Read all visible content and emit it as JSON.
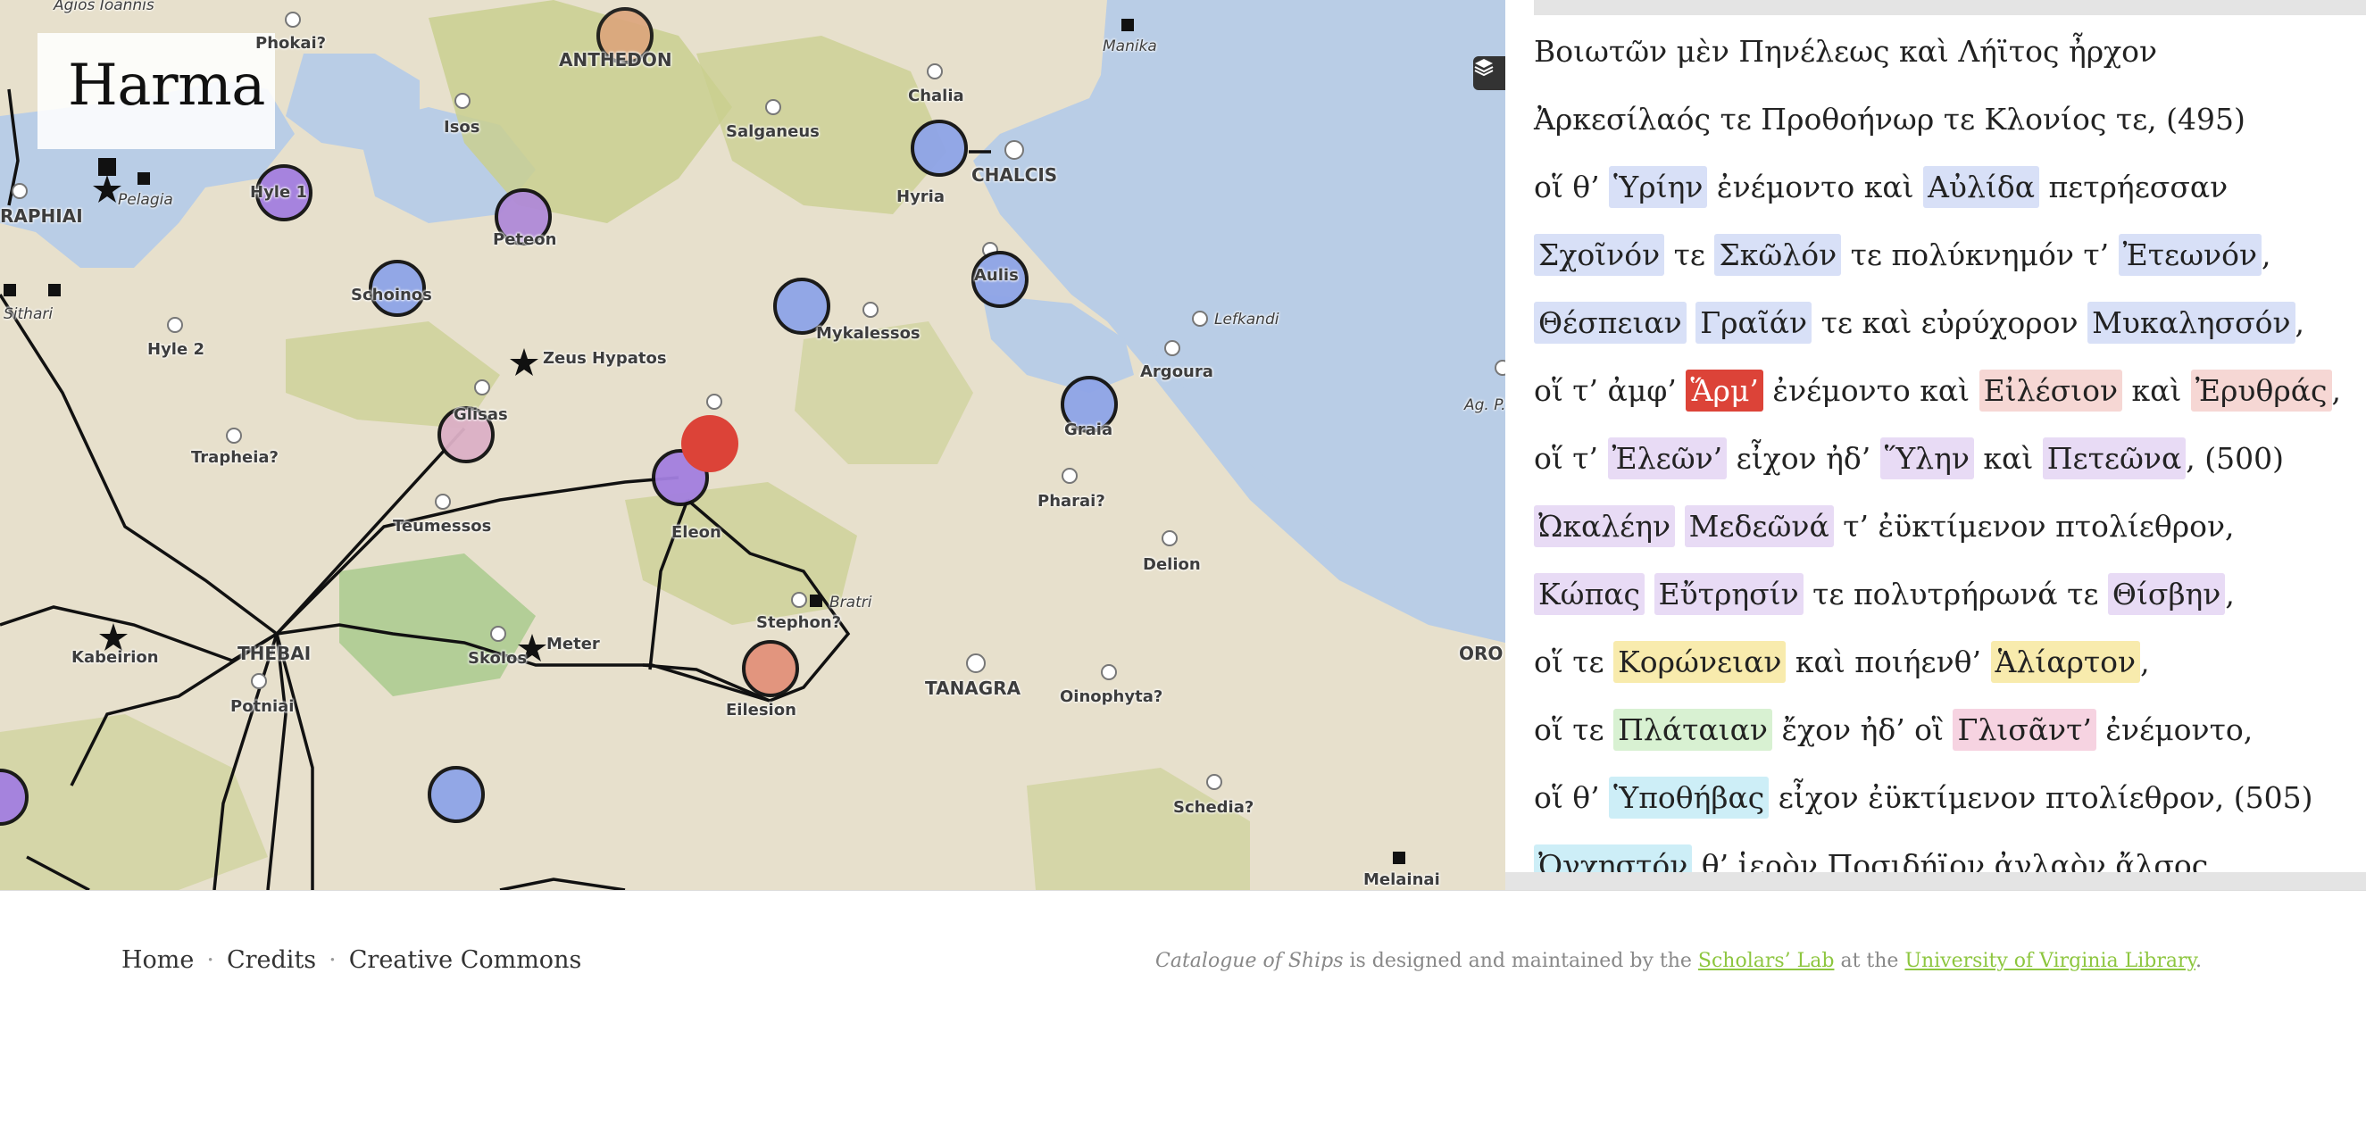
{
  "map": {
    "title": "Harma",
    "layers_icon": "layers-icon",
    "labels": [
      {
        "text": "ANTHEDON"
      },
      {
        "text": "Phokai?"
      },
      {
        "text": "Chalia"
      },
      {
        "text": "Manika"
      },
      {
        "text": "Isos"
      },
      {
        "text": "Salganeus"
      },
      {
        "text": "Hyria"
      },
      {
        "text": "CHALCIS"
      },
      {
        "text": "Hyle 1"
      },
      {
        "text": "Pelagia"
      },
      {
        "text": "RAPHIAI"
      },
      {
        "text": "Peteon"
      },
      {
        "text": "Aulis"
      },
      {
        "text": "Schoinos"
      },
      {
        "text": "Mykalessos"
      },
      {
        "text": "Lefkandi"
      },
      {
        "text": "Hyle 2"
      },
      {
        "text": "Zeus Hypatos"
      },
      {
        "text": "Argoura"
      },
      {
        "text": "Graia"
      },
      {
        "text": "Glisas"
      },
      {
        "text": "Trapheia?"
      },
      {
        "text": "Pharai?"
      },
      {
        "text": "Eleon"
      },
      {
        "text": "Teumessos"
      },
      {
        "text": "Delion"
      },
      {
        "text": "Bratri"
      },
      {
        "text": "Stephon?"
      },
      {
        "text": "Kabeirion"
      },
      {
        "text": "THEBAI"
      },
      {
        "text": "Meter"
      },
      {
        "text": "Skolos"
      },
      {
        "text": "TANAGRA"
      },
      {
        "text": "Oinophyta?"
      },
      {
        "text": "Eilesion"
      },
      {
        "text": "Potniai"
      },
      {
        "text": "Schedia?"
      },
      {
        "text": "Melainai"
      },
      {
        "text": "ORO"
      },
      {
        "text": "Ag. P."
      },
      {
        "text": "Sithari"
      },
      {
        "text": "Agios Ioannis"
      }
    ],
    "colors": {
      "active_marker": "#dc4338",
      "sea": "#b9cde6",
      "land": "#e7e0cc",
      "hills": "#c9cf8f"
    }
  },
  "text": {
    "lines": [
      [
        {
          "t": "Βοιωτῶν μὲν Πηνέλεως καὶ Λήϊτος ἦρχον"
        }
      ],
      [
        {
          "t": "Ἀρκεσίλαός τε Προθοήνωρ τε Κλονίος τε, (495)"
        }
      ],
      [
        {
          "t": "οἵ θ’ "
        },
        {
          "t": "Ὑρίην",
          "c": "blue"
        },
        {
          "t": " ἐνέμοντο καὶ "
        },
        {
          "t": "Αὐλίδα",
          "c": "blue"
        },
        {
          "t": " πετρήεσσαν"
        }
      ],
      [
        {
          "t": "Σχοῖνόν",
          "c": "blue"
        },
        {
          "t": " τε "
        },
        {
          "t": "Σκῶλόν",
          "c": "blue"
        },
        {
          "t": " τε πολύκνημόν τ’ "
        },
        {
          "t": "Ἐτεωνόν",
          "c": "blue"
        },
        {
          "t": ","
        }
      ],
      [
        {
          "t": "Θέσπειαν",
          "c": "blue"
        },
        {
          "t": " "
        },
        {
          "t": "Γραῖάν",
          "c": "blue"
        },
        {
          "t": " τε καὶ εὐρύχορον "
        },
        {
          "t": "Μυκαλησσόν",
          "c": "blue"
        },
        {
          "t": ","
        }
      ],
      [
        {
          "t": "οἵ τ’ ἀμφ’ "
        },
        {
          "t": "Ἅρμ’",
          "c": "active"
        },
        {
          "t": " ἐνέμοντο καὶ "
        },
        {
          "t": "Εἰλέσιον",
          "c": "red"
        },
        {
          "t": " καὶ "
        },
        {
          "t": "Ἐρυθράς",
          "c": "red"
        },
        {
          "t": ","
        }
      ],
      [
        {
          "t": "οἵ τ’ "
        },
        {
          "t": "Ἐλεῶν’",
          "c": "purple"
        },
        {
          "t": " εἶχον ἠδ’ "
        },
        {
          "t": "Ὕλην",
          "c": "purple"
        },
        {
          "t": " καὶ "
        },
        {
          "t": "Πετεῶνα",
          "c": "purple"
        },
        {
          "t": ", (500)"
        }
      ],
      [
        {
          "t": "Ὠκαλέην",
          "c": "purple"
        },
        {
          "t": " "
        },
        {
          "t": "Μεδεῶνά",
          "c": "purple"
        },
        {
          "t": " τ’ ἐϋκτίμενον πτολίεθρον,"
        }
      ],
      [
        {
          "t": "Κώπας",
          "c": "purple"
        },
        {
          "t": " "
        },
        {
          "t": "Εὔτρησίν",
          "c": "purple"
        },
        {
          "t": " τε πολυτρήρωνά τε "
        },
        {
          "t": "Θίσβην",
          "c": "purple"
        },
        {
          "t": ","
        }
      ],
      [
        {
          "t": "οἵ τε "
        },
        {
          "t": "Κορώνειαν",
          "c": "yellow"
        },
        {
          "t": " καὶ ποιήενθ’ "
        },
        {
          "t": "Ἁλίαρτον",
          "c": "yellow"
        },
        {
          "t": ","
        }
      ],
      [
        {
          "t": "οἵ τε "
        },
        {
          "t": "Πλάταιαν",
          "c": "green"
        },
        {
          "t": " ἔχον ἠδ’ οἳ "
        },
        {
          "t": "Γλισᾶντ’",
          "c": "pink"
        },
        {
          "t": " ἐνέμοντο,"
        }
      ],
      [
        {
          "t": "οἵ θ’ "
        },
        {
          "t": "Ὑποθήβας",
          "c": "cyan"
        },
        {
          "t": " εἶχον ἐϋκτίμενον πτολίεθρον, (505)"
        }
      ],
      [
        {
          "t": "Ὀγχηστόν",
          "c": "cyan"
        },
        {
          "t": " θ’ ἱερὸν Ποσιδήϊον ἀγλαὸν ἄλσος,"
        }
      ]
    ]
  },
  "footer": {
    "nav": [
      "Home",
      "Credits",
      "Creative Commons"
    ],
    "separator": "·",
    "credit": {
      "title": "Catalogue of Ships",
      "mid1": " is designed and maintained by the ",
      "link1": "Scholars’ Lab",
      "mid2": " at the ",
      "link2": "University of Virginia Library",
      "end": "."
    }
  }
}
